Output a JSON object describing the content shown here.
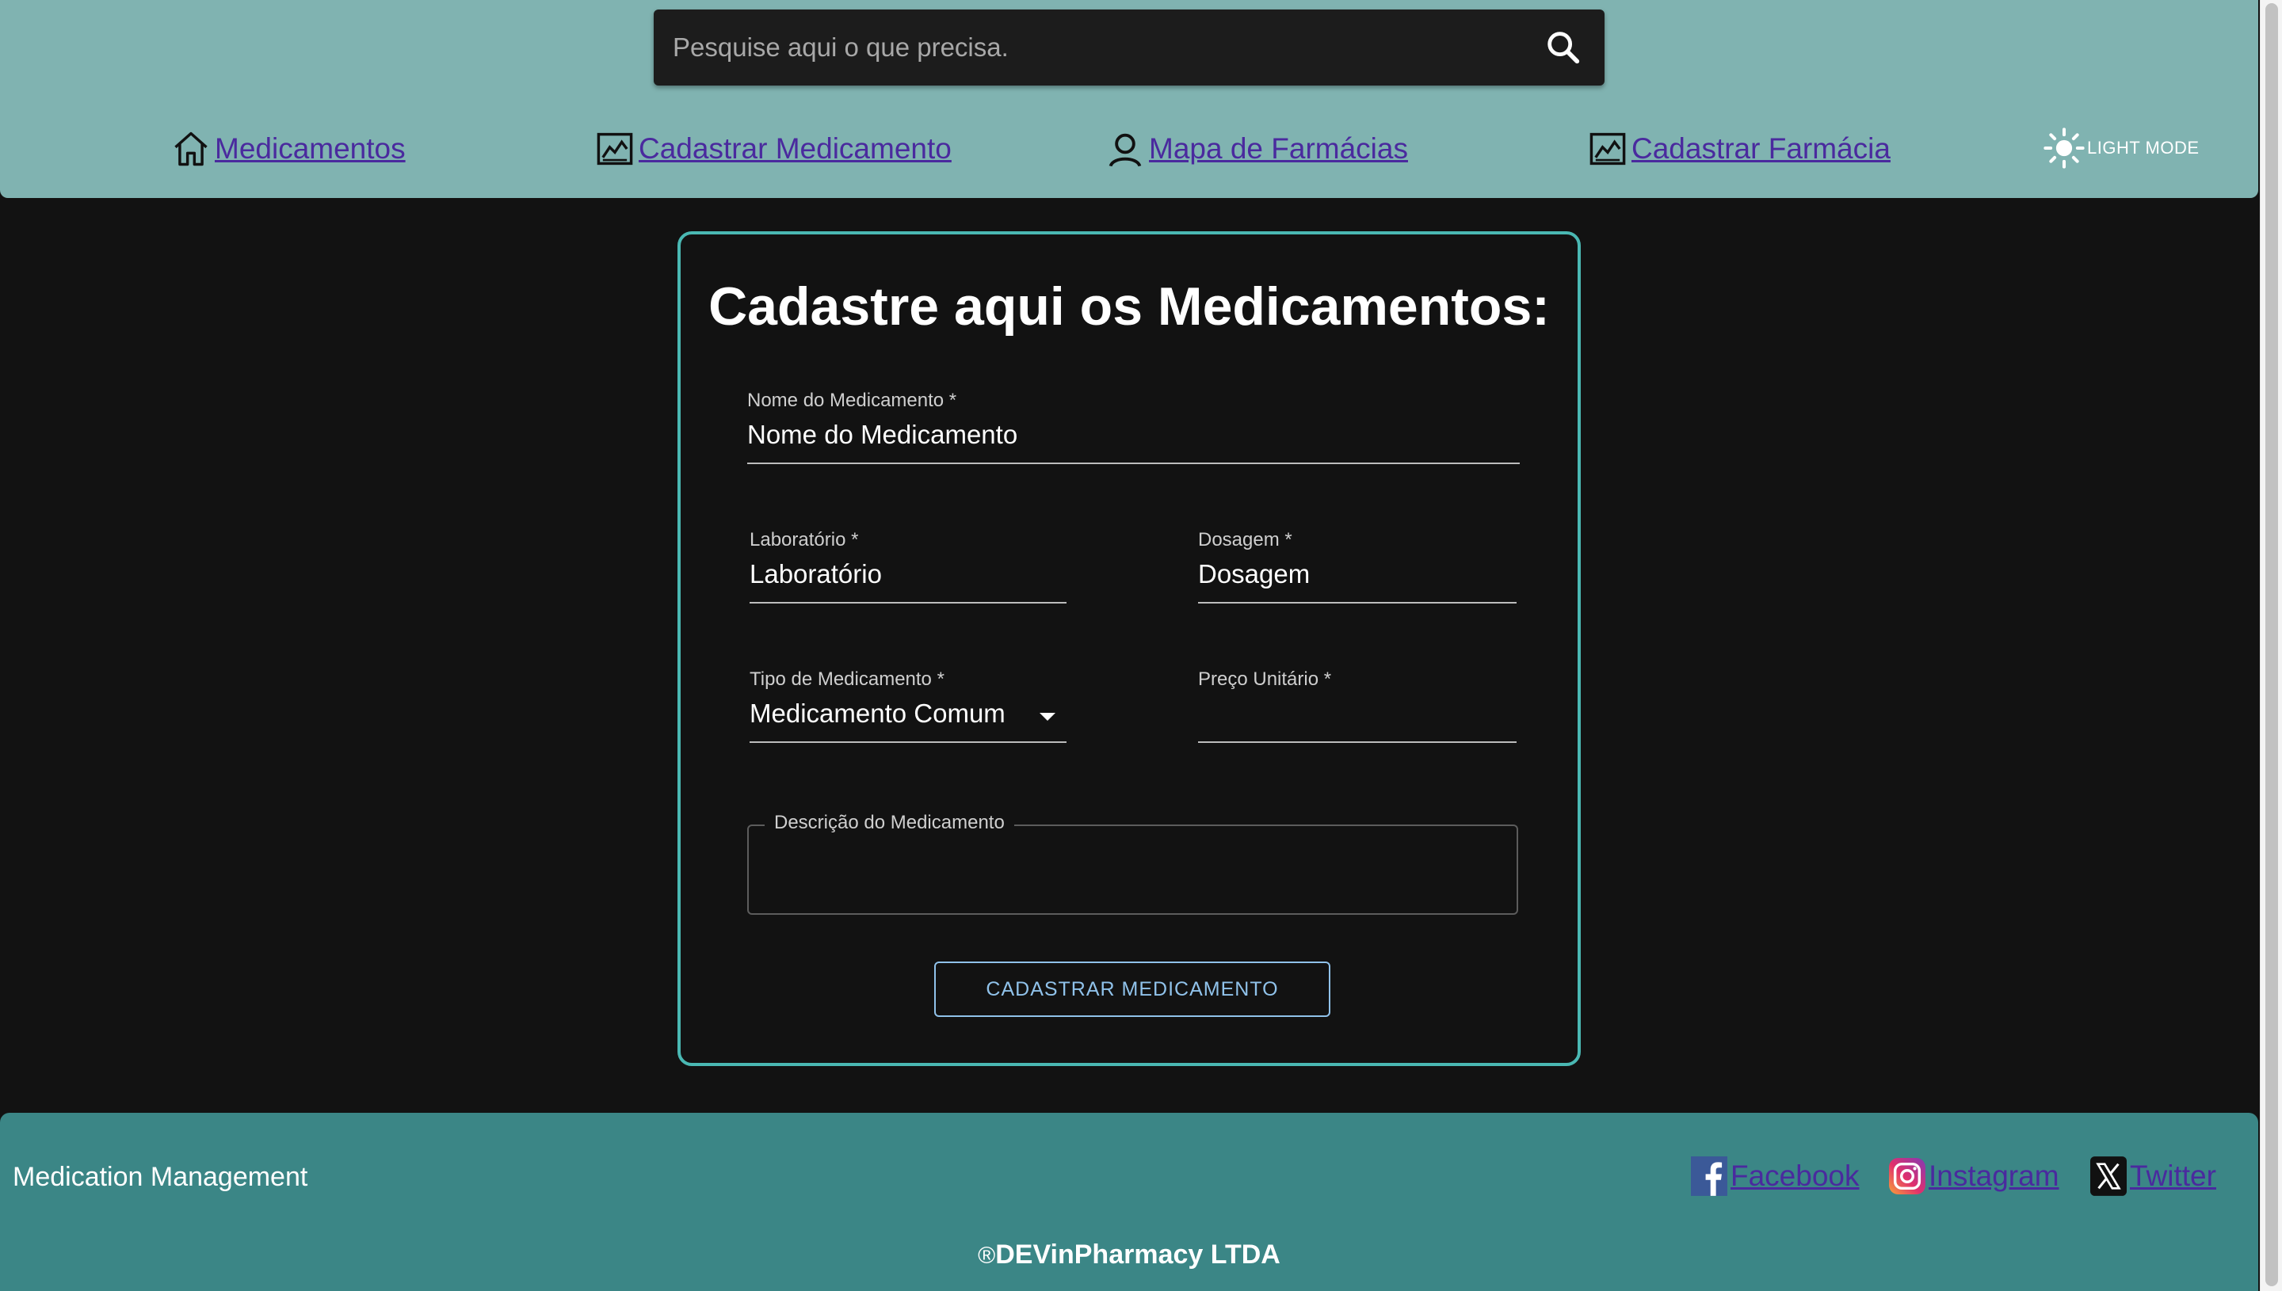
{
  "header": {
    "search": {
      "placeholder": "Pesquise aqui o que precisa."
    },
    "nav": [
      {
        "label": "Medicamentos",
        "icon": "home-icon"
      },
      {
        "label": "Cadastrar Medicamento",
        "icon": "chart-image-icon"
      },
      {
        "label": "Mapa de Farmácias",
        "icon": "person-icon"
      },
      {
        "label": "Cadastrar Farmácia",
        "icon": "chart-image-icon"
      }
    ],
    "theme_toggle": {
      "label": "LIGHT MODE",
      "icon": "sun-icon"
    }
  },
  "form": {
    "title": "Cadastre aqui os Medicamentos:",
    "fields": {
      "name": {
        "label": "Nome do Medicamento",
        "required": "*",
        "value": "Nome do Medicamento"
      },
      "lab": {
        "label": "Laboratório",
        "required": "*",
        "value": "Laboratório"
      },
      "dosage": {
        "label": "Dosagem",
        "required": "*",
        "value": "Dosagem"
      },
      "type": {
        "label": "Tipo de Medicamento",
        "required": "*",
        "value": "Medicamento Comum"
      },
      "price": {
        "label": "Preço Unitário",
        "required": "*",
        "value": ""
      },
      "description": {
        "label": "Descrição do Medicamento",
        "value": ""
      }
    },
    "submit_label": "CADASTRAR MEDICAMENTO"
  },
  "footer": {
    "brand": "Medication Management",
    "social": [
      {
        "label": "Facebook",
        "icon": "facebook-icon"
      },
      {
        "label": "Instagram",
        "icon": "instagram-icon"
      },
      {
        "label": "Twitter",
        "icon": "x-twitter-icon"
      }
    ],
    "copyright_symbol": "®",
    "copyright": "DEVinPharmacy LTDA"
  },
  "colors": {
    "header_bg": "#80b3b1",
    "footer_bg": "#3b8686",
    "card_border": "#4ab8b3",
    "link": "#4a2a9e",
    "button_accent": "#90c2ea"
  }
}
